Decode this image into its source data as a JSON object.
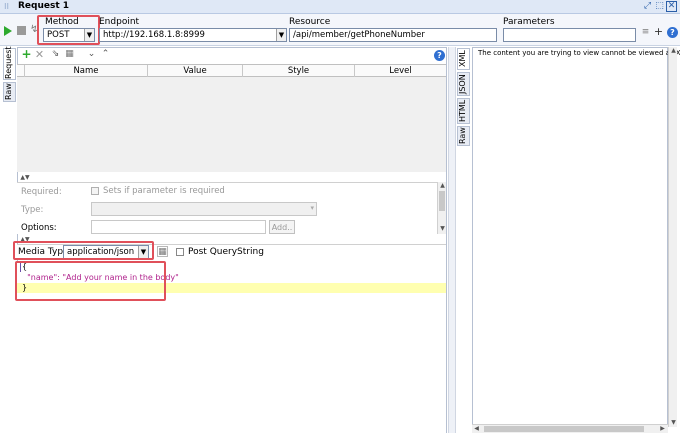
{
  "window": {
    "title": "Request 1"
  },
  "toolbar": {
    "method_label": "Method",
    "method_value": "POST",
    "endpoint_label": "Endpoint",
    "endpoint_value": "http://192.168.1.8:8999",
    "resource_label": "Resource",
    "resource_value": "/api/member/getPhoneNumber",
    "parameters_label": "Parameters",
    "parameters_value": ""
  },
  "request_tabs": {
    "request": "Request",
    "raw": "Raw"
  },
  "params_table": {
    "columns": [
      "Name",
      "Value",
      "Style",
      "Level"
    ]
  },
  "param_details": {
    "required_label": "Required:",
    "required_checkbox_label": "Sets if parameter is required",
    "type_label": "Type:",
    "options_label": "Options:",
    "add_button": "Add.."
  },
  "media": {
    "label": "Media Type",
    "value": "application/json",
    "post_querystring_label": "Post QueryString"
  },
  "body_editor": {
    "lines": [
      "{",
      "  \"name\": \"Add your name in the body\"",
      "}"
    ]
  },
  "response_tabs": {
    "xml": "XML",
    "json": "JSON",
    "html": "HTML",
    "raw": "Raw"
  },
  "response": {
    "message": "The content you are trying to view cannot be viewed as XML"
  },
  "colors": {
    "highlight": "#e0505a",
    "editor_line": "#ffffb0",
    "json_key": "#b0228c"
  }
}
